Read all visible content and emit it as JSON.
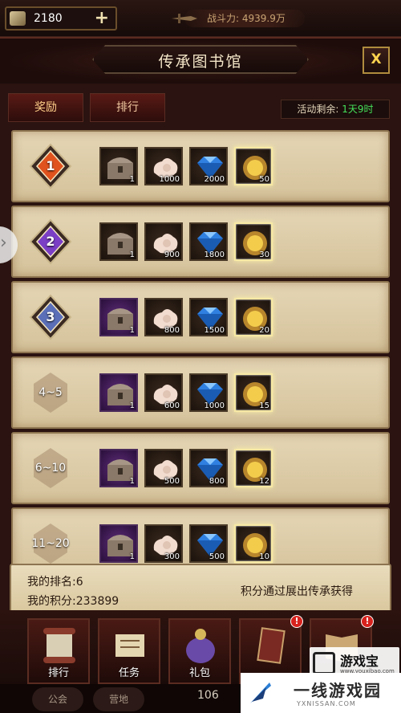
{
  "topbar": {
    "gems": "2180",
    "plus": "+",
    "power": "战斗力: 4939.9万"
  },
  "window": {
    "title": "传承图书馆",
    "close": "X",
    "tabs": [
      "奖励",
      "排行"
    ],
    "timer_label": "活动剩余: ",
    "timer_value": "1天9时"
  },
  "rewards": [
    {
      "rank": "1",
      "items": [
        {
          "icon": "chest-icon",
          "qty": "1"
        },
        {
          "icon": "ore-icon",
          "qty": "1000"
        },
        {
          "icon": "gem-icon",
          "qty": "2000"
        },
        {
          "icon": "coin-icon",
          "qty": "50"
        }
      ]
    },
    {
      "rank": "2",
      "items": [
        {
          "icon": "chest-icon",
          "qty": "1"
        },
        {
          "icon": "ore-icon",
          "qty": "900"
        },
        {
          "icon": "gem-icon",
          "qty": "1800"
        },
        {
          "icon": "coin-icon",
          "qty": "30"
        }
      ]
    },
    {
      "rank": "3",
      "items": [
        {
          "icon": "chest-icon",
          "qty": "1"
        },
        {
          "icon": "ore-icon",
          "qty": "800"
        },
        {
          "icon": "gem-icon",
          "qty": "1500"
        },
        {
          "icon": "coin-icon",
          "qty": "20"
        }
      ]
    },
    {
      "rank": "4~5",
      "items": [
        {
          "icon": "chest-icon",
          "qty": "1"
        },
        {
          "icon": "ore-icon",
          "qty": "600"
        },
        {
          "icon": "gem-icon",
          "qty": "1000"
        },
        {
          "icon": "coin-icon",
          "qty": "15"
        }
      ]
    },
    {
      "rank": "6~10",
      "items": [
        {
          "icon": "chest-icon",
          "qty": "1"
        },
        {
          "icon": "ore-icon",
          "qty": "500"
        },
        {
          "icon": "gem-icon",
          "qty": "800"
        },
        {
          "icon": "coin-icon",
          "qty": "12"
        }
      ]
    },
    {
      "rank": "11~20",
      "items": [
        {
          "icon": "chest-icon",
          "qty": "1"
        },
        {
          "icon": "ore-icon",
          "qty": "300"
        },
        {
          "icon": "gem-icon",
          "qty": "500"
        },
        {
          "icon": "coin-icon",
          "qty": "10"
        }
      ]
    }
  ],
  "footer": {
    "my_rank": "我的排名:6",
    "my_score": "我的积分:233899",
    "tip": "积分通过展出传承获得"
  },
  "bottom_nav": [
    "排行",
    "任务",
    "礼包",
    "",
    ""
  ],
  "bottom_bar": {
    "guild": "公会",
    "home": "营地",
    "level": "106"
  },
  "watermark": {
    "text1": "游戏宝",
    "sub1": "www.youxibao.com",
    "text2": "一线游戏园",
    "sub2": "YXNISSAN.COM"
  },
  "colors": {
    "gold_accent": "#ffd34f",
    "timer_green": "#45e05a",
    "parchment": "#e5d6b5"
  }
}
